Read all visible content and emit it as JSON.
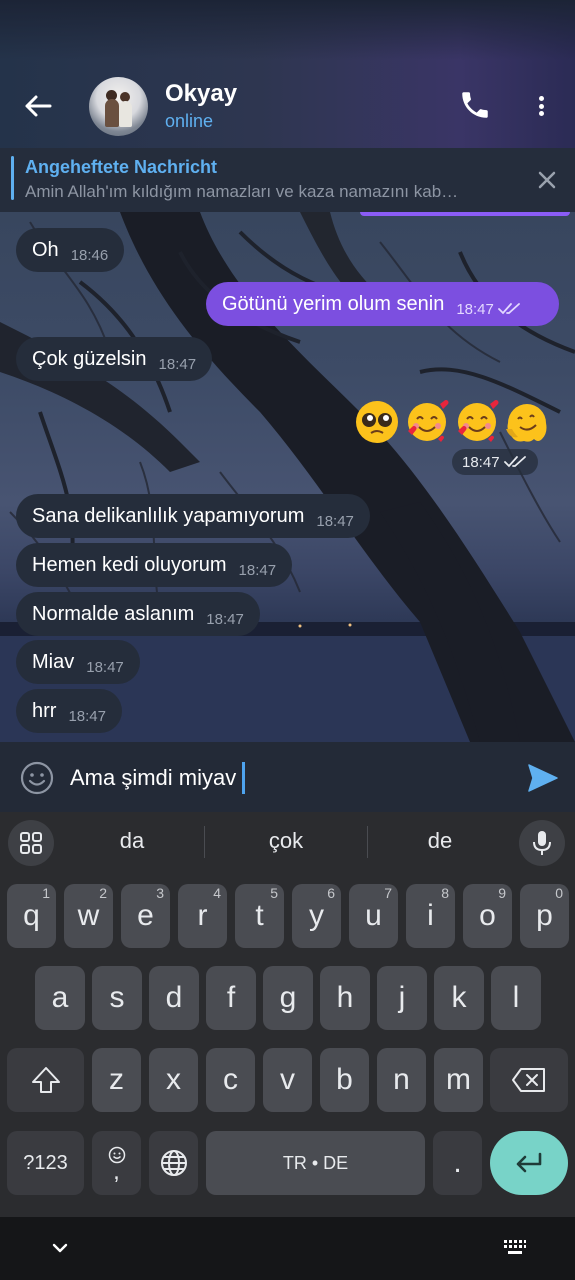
{
  "header": {
    "name": "Okyay",
    "status": "online"
  },
  "pinned": {
    "title": "Angeheftete Nachricht",
    "text": "Amin Allah'ım kıldığım namazları ve kaza namazını kab…"
  },
  "messages": [
    {
      "text": "Oh",
      "time": "18:46",
      "dir": "in"
    },
    {
      "text": "Götünü yerim olum senin",
      "time": "18:47",
      "dir": "out"
    },
    {
      "text": "Çok güzelsin",
      "time": "18:47",
      "dir": "in"
    },
    {
      "text": "",
      "time": "18:47",
      "dir": "out",
      "emoji": [
        "pleading-face-emoji",
        "smiling-face-with-hearts-emoji",
        "smiling-face-with-hearts-emoji",
        "melting-face-emoji"
      ]
    },
    {
      "text": "Sana delikanlılık yapamıyorum",
      "time": "18:47",
      "dir": "in"
    },
    {
      "text": "Hemen kedi oluyorum",
      "time": "18:47",
      "dir": "in"
    },
    {
      "text": "Normalde aslanım",
      "time": "18:47",
      "dir": "in"
    },
    {
      "text": "Miav",
      "time": "18:47",
      "dir": "in"
    },
    {
      "text": "hrr",
      "time": "18:47",
      "dir": "in"
    }
  ],
  "input": {
    "value": "Ama şimdi miyav"
  },
  "keyboard": {
    "suggestions": [
      "da",
      "çok",
      "de"
    ],
    "row1": [
      {
        "k": "q",
        "n": "1"
      },
      {
        "k": "w",
        "n": "2"
      },
      {
        "k": "e",
        "n": "3"
      },
      {
        "k": "r",
        "n": "4"
      },
      {
        "k": "t",
        "n": "5"
      },
      {
        "k": "y",
        "n": "6"
      },
      {
        "k": "u",
        "n": "7"
      },
      {
        "k": "i",
        "n": "8"
      },
      {
        "k": "o",
        "n": "9"
      },
      {
        "k": "p",
        "n": "0"
      }
    ],
    "row2": [
      "a",
      "s",
      "d",
      "f",
      "g",
      "h",
      "j",
      "k",
      "l"
    ],
    "row3": [
      "z",
      "x",
      "c",
      "v",
      "b",
      "n",
      "m"
    ],
    "symbols_label": "?123",
    "emoji_comma_label": ",",
    "space_label": "TR • DE",
    "period_label": "."
  },
  "colors": {
    "outgoing_bubble": "#7c4fe0",
    "incoming_bubble": "#252d3b",
    "accent": "#5fb0f0",
    "enter_key": "#78d3c8"
  }
}
